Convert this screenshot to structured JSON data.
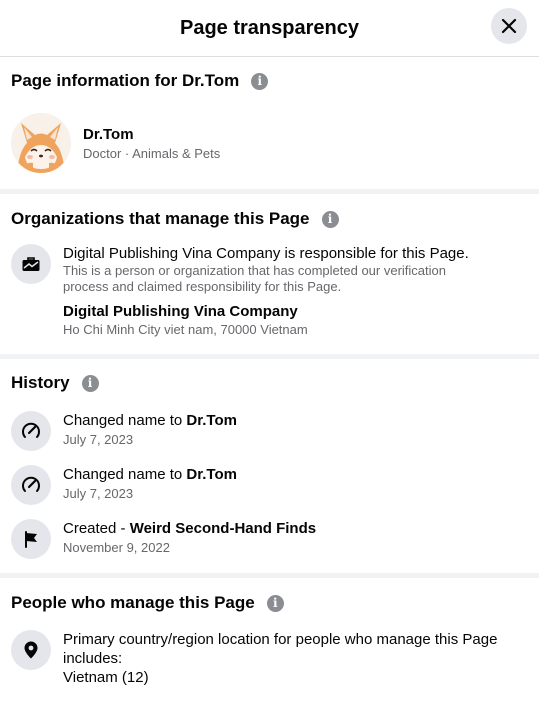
{
  "header": {
    "title": "Page transparency"
  },
  "page_info": {
    "title": "Page information for Dr.Tom",
    "name": "Dr.Tom",
    "category": "Doctor · Animals & Pets"
  },
  "organizations": {
    "title": "Organizations that manage this Page",
    "statement": "Digital Publishing Vina Company is responsible for this Page.",
    "description": "This is a person or organization that has completed our verification process and claimed responsibility for this Page.",
    "org_name": "Digital Publishing Vina Company",
    "address": "Ho Chi Minh City viet nam, 70000 Vietnam"
  },
  "history": {
    "title": "History",
    "items": [
      {
        "action": "Changed name to ",
        "subject": "Dr.Tom",
        "date": "July 7, 2023",
        "icon": "edit-icon"
      },
      {
        "action": "Changed name to ",
        "subject": "Dr.Tom",
        "date": "July 7, 2023",
        "icon": "edit-icon"
      },
      {
        "action": "Created - ",
        "subject": "Weird Second-Hand Finds",
        "date": "November 9, 2022",
        "icon": "flag-icon"
      }
    ]
  },
  "people": {
    "title": "People who manage this Page",
    "location_text": "Primary country/region location for people who manage this Page includes:",
    "countries": "Vietnam (12)"
  },
  "icons": {
    "info": "i"
  }
}
